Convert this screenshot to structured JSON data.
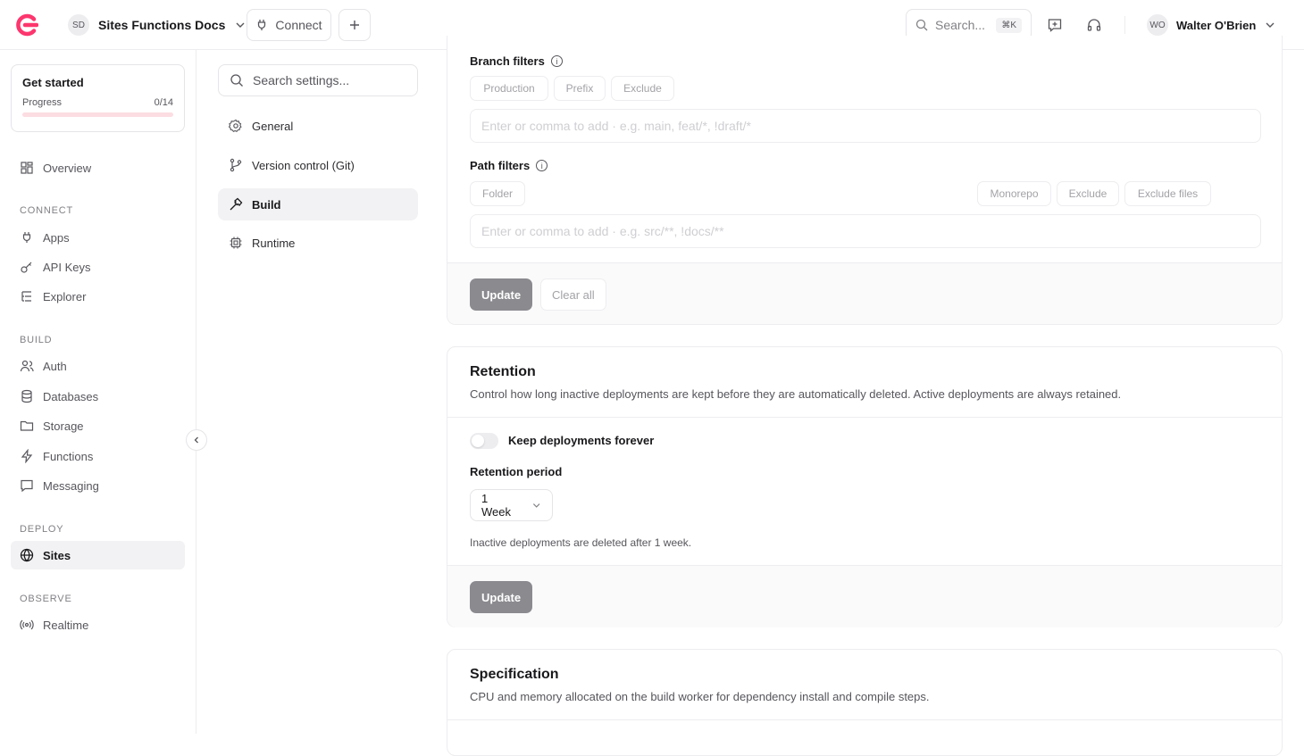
{
  "topbar": {
    "project_initials": "SD",
    "project_name": "Sites Functions Docs",
    "connect_label": "Connect",
    "search_placeholder": "Search...",
    "search_shortcut": "⌘K",
    "user_initials": "WO",
    "user_name": "Walter O'Brien",
    "brand_color": "#fd366e"
  },
  "sidebar": {
    "get_started": {
      "title": "Get started",
      "progress_label": "Progress",
      "progress_value": "0/14",
      "progress_fraction": 0
    },
    "overview": "Overview",
    "sections": {
      "connect": "CONNECT",
      "build": "BUILD",
      "deploy": "DEPLOY",
      "observe": "OBSERVE"
    },
    "items": {
      "apps": "Apps",
      "api_keys": "API Keys",
      "explorer": "Explorer",
      "auth": "Auth",
      "databases": "Databases",
      "storage": "Storage",
      "functions": "Functions",
      "messaging": "Messaging",
      "sites": "Sites",
      "realtime": "Realtime"
    }
  },
  "settings_nav": {
    "search_placeholder": "Search settings...",
    "items": [
      "General",
      "Version control (Git)",
      "Build",
      "Runtime"
    ],
    "active": "Build"
  },
  "filters": {
    "branch_label": "Branch filters",
    "branch_chips": [
      "Production",
      "Prefix",
      "Exclude"
    ],
    "branch_placeholder": "Enter or comma to add · e.g. main, feat/*, !draft/*",
    "path_label": "Path filters",
    "path_chips": [
      "Folder",
      "Monorepo",
      "Exclude",
      "Exclude files"
    ],
    "path_placeholder": "Enter or comma to add · e.g. src/**, !docs/**",
    "update_label": "Update",
    "clear_label": "Clear all"
  },
  "retention": {
    "title": "Retention",
    "description": "Control how long inactive deployments are kept before they are automatically deleted. Active deployments are always retained.",
    "toggle_label": "Keep deployments forever",
    "toggle_on": false,
    "period_label": "Retention period",
    "period_value": "1 Week",
    "hint": "Inactive deployments are deleted after 1 week.",
    "update_label": "Update"
  },
  "specification": {
    "title": "Specification",
    "description": "CPU and memory allocated on the build worker for dependency install and compile steps."
  }
}
